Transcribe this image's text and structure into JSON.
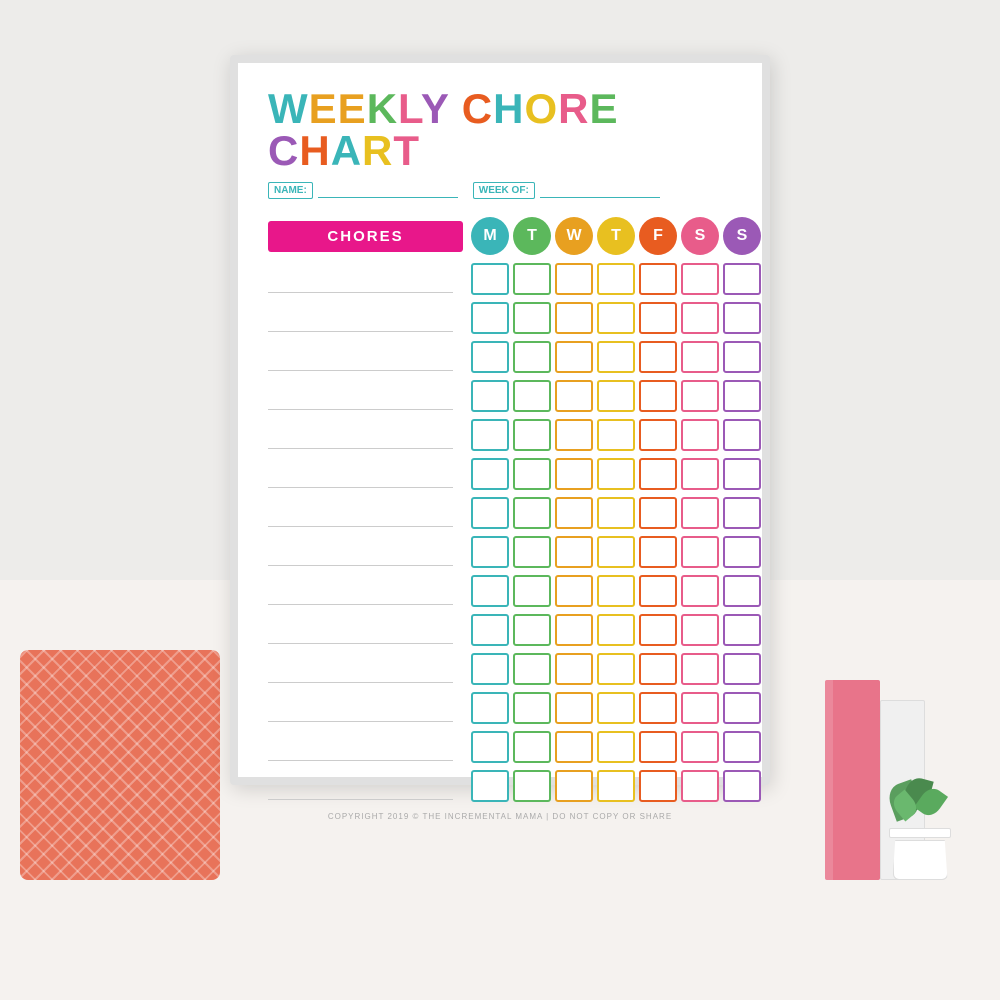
{
  "scene": {
    "background_wall": "#edecea",
    "background_shelf": "#f5f2ef"
  },
  "chart": {
    "title": "WEEKLY CHORE CHART",
    "title_letters": [
      "W",
      "E",
      "E",
      "K",
      "L",
      "Y",
      " ",
      "C",
      "H",
      "O",
      "R",
      "E",
      " ",
      "C",
      "H",
      "A",
      "R",
      "T"
    ],
    "name_label": "NAME:",
    "week_label": "WEEK OF:",
    "chores_label": "CHORES",
    "days": [
      {
        "letter": "M",
        "color": "#3ab5b8"
      },
      {
        "letter": "T",
        "color": "#5cb85c"
      },
      {
        "letter": "W",
        "color": "#e8a020"
      },
      {
        "letter": "T",
        "color": "#e8c020"
      },
      {
        "letter": "F",
        "color": "#e85c20"
      },
      {
        "letter": "S",
        "color": "#e85c8a"
      },
      {
        "letter": "S",
        "color": "#9b59b6"
      }
    ],
    "day_colors": [
      "#3ab5b8",
      "#5cb85c",
      "#e8a020",
      "#e8c020",
      "#e85c20",
      "#e85c8a",
      "#9b59b6"
    ],
    "num_rows": 14,
    "copyright": "COPYRIGHT 2019 © THE INCREMENTAL MAMA | DO NOT COPY OR SHARE"
  }
}
